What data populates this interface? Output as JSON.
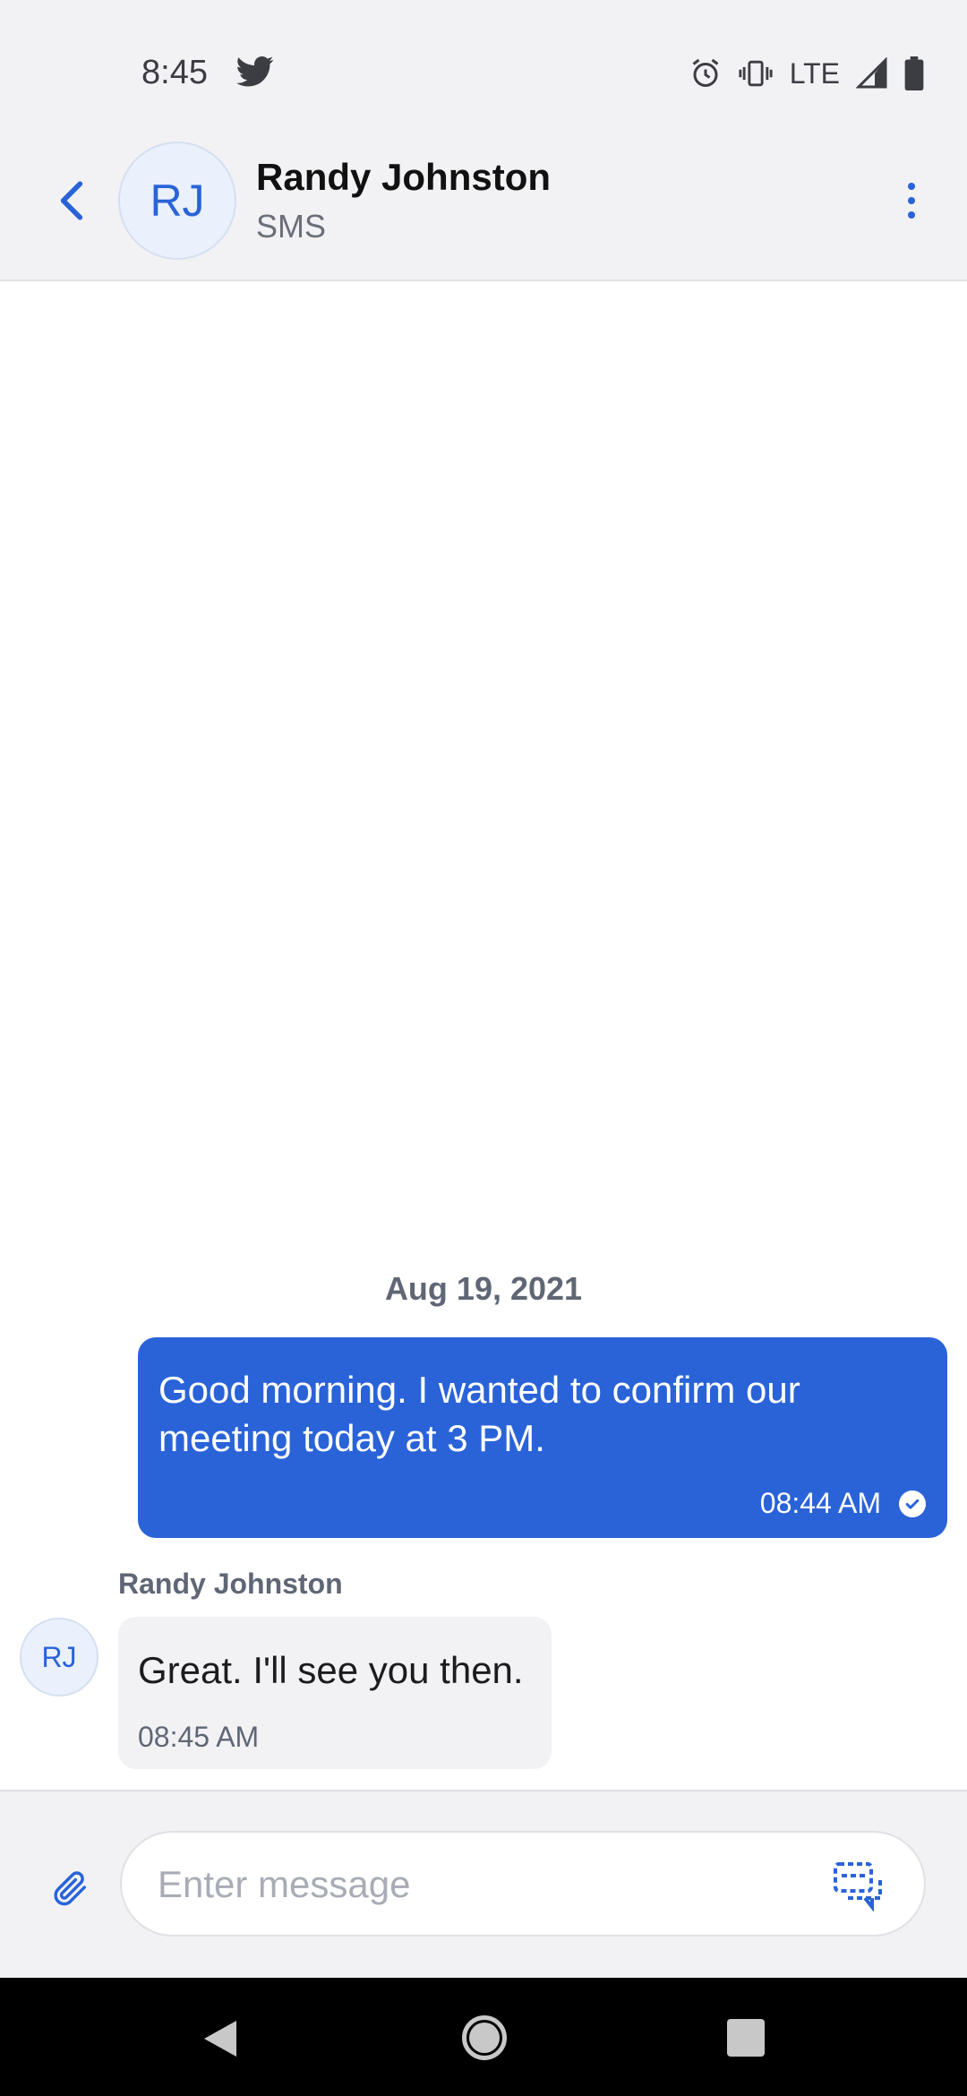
{
  "status_bar": {
    "time": "8:45",
    "network": "LTE",
    "icons": [
      "twitter-icon",
      "alarm-icon",
      "vibrate-icon",
      "signal-icon",
      "battery-icon"
    ]
  },
  "header": {
    "avatar_initials": "RJ",
    "contact_name": "Randy Johnston",
    "channel": "SMS",
    "icons": [
      "chevron-left-icon",
      "more-vertical-icon"
    ]
  },
  "conversation": {
    "date_separator": "Aug 19, 2021",
    "messages": [
      {
        "direction": "outgoing",
        "text": "Good morning. I wanted to confirm our meeting today at 3 PM.",
        "time": "08:44 AM",
        "status": "delivered"
      },
      {
        "direction": "incoming",
        "sender": "Randy Johnston",
        "avatar_initials": "RJ",
        "text": "Great. I'll see you then.",
        "time": "08:45 AM"
      }
    ]
  },
  "composer": {
    "placeholder": "Enter message",
    "value": "",
    "icons": [
      "paperclip-icon",
      "message-template-icon"
    ]
  },
  "colors": {
    "accent": "#2a63d8",
    "outgoing_bubble": "#2a63d8",
    "incoming_bubble": "#f2f2f5",
    "header_bg": "#f2f2f5"
  }
}
